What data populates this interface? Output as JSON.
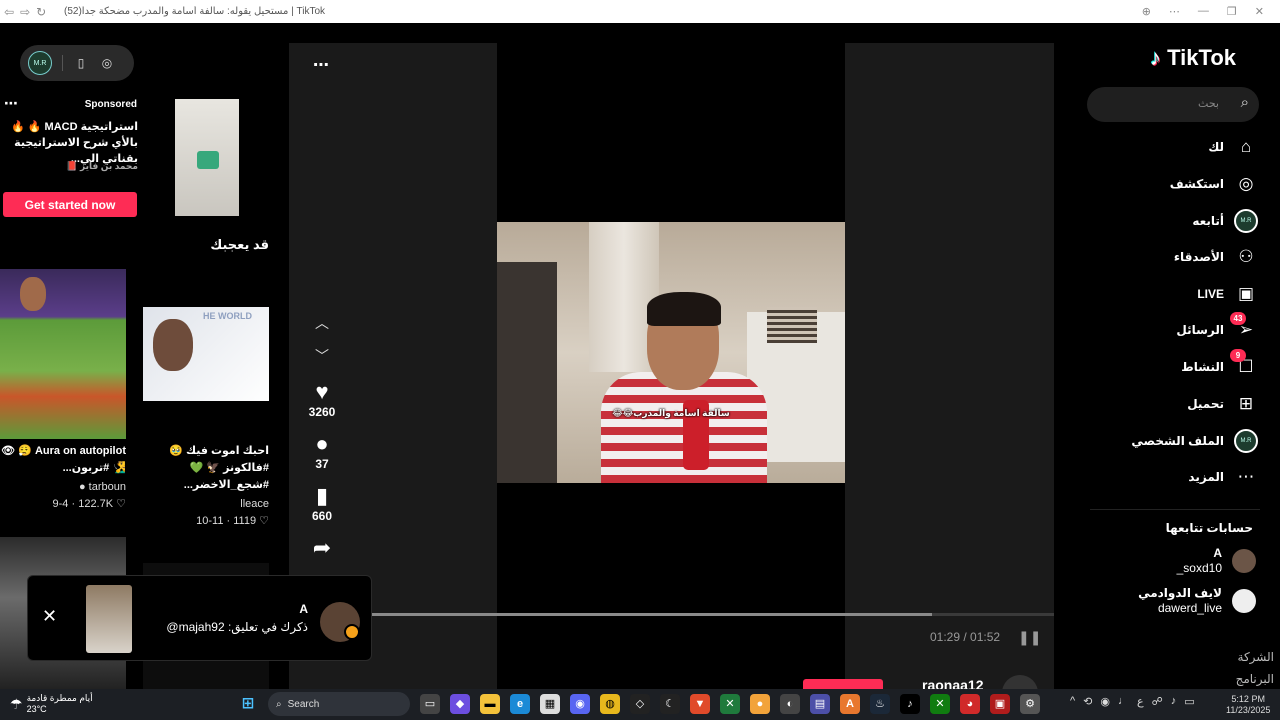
{
  "browser": {
    "title": "مستحيل يقوله: سالفة أسامة والمدرب مضحكة جداً(52) | TikTok"
  },
  "toppill": {
    "avatar_text": "M.R"
  },
  "ad": {
    "sponsored": "Sponsored",
    "headline": "استراتيجية MACD 🔥 🔥 بالأي شرح الاستراتيجية بقناتي الي...",
    "author": "محمد بن فايز 📕",
    "cta": "Get started now"
  },
  "may_like": "قد يعجبك",
  "cards": [
    {
      "caption": "احبك اموت فيك 🥹 #فالكونز 🦅 💚 #شجع_الاخضر...",
      "user": "lleace",
      "stats": "10-11 · 1119 ♡"
    },
    {
      "caption": "Aura on autopilot 😮‍💨 👁 🧏‍♂️ #تربون...",
      "user": "● tarboun",
      "stats": "9-4 · 122.7K ♡"
    }
  ],
  "video": {
    "subtitle": "سالفة اسامة والمدرب😂😂",
    "time": "01:29 / 01:52",
    "progress": 0.84,
    "likes": "3260",
    "comments": "37",
    "saves": "660",
    "author": "raonaa12"
  },
  "toast": {
    "name": "A",
    "message": "ذكرك في تعليق: majah92@"
  },
  "sidebar": {
    "logo": "TikTok",
    "search_placeholder": "بحث",
    "nav": [
      {
        "label": "لك",
        "icon": "home-icon"
      },
      {
        "label": "استكشف",
        "icon": "compass-icon"
      },
      {
        "label": "أتابعه",
        "icon": "following-avatar-icon"
      },
      {
        "label": "الأصدقاء",
        "icon": "friends-icon"
      },
      {
        "label": "LIVE",
        "icon": "live-icon"
      },
      {
        "label": "الرسائل",
        "icon": "messages-icon",
        "count": "43"
      },
      {
        "label": "النشاط",
        "icon": "activity-icon",
        "count": "9"
      },
      {
        "label": "تحميل",
        "icon": "upload-icon"
      },
      {
        "label": "الملف الشخصي",
        "icon": "profile-icon"
      },
      {
        "label": "المزيد",
        "icon": "more-icon"
      }
    ],
    "following_title": "حسابات تتابعها",
    "following": [
      {
        "name": "A",
        "handle": "_soxd10"
      },
      {
        "name": "لايف الدوادمي",
        "handle": "dawerd_live"
      }
    ],
    "footer": [
      "الشركة",
      "البرنامج"
    ]
  },
  "taskbar": {
    "weather_line1": "أيام ممطرة قادمة",
    "weather_line2": "23°C",
    "search": "Search",
    "clock_time": "5:12 PM",
    "clock_date": "11/23/2025",
    "lang": "ع"
  },
  "colors": {
    "accent": "#fe2c55",
    "background": "#000000",
    "panel": "#1a1a1a"
  }
}
